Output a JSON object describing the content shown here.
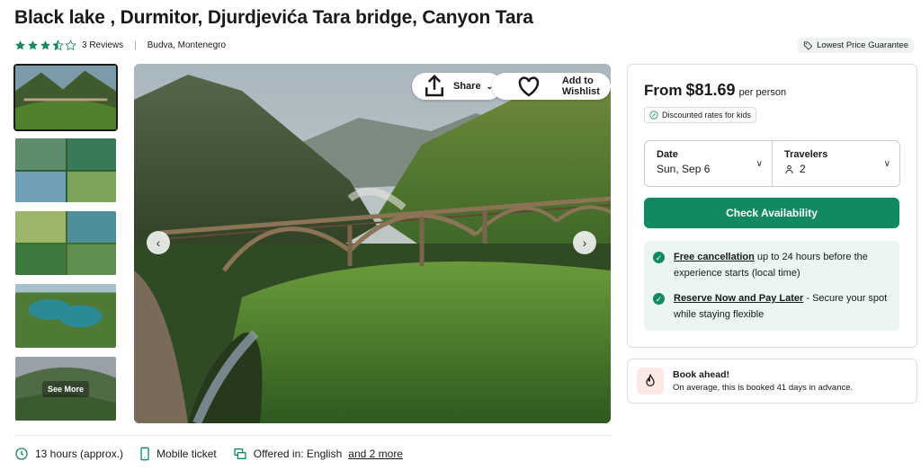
{
  "title": "Black lake , Durmitor, Djurdjevića Tara bridge, Canyon Tara",
  "rating": {
    "stars": 3.5,
    "reviews_label": "3 Reviews"
  },
  "location": "Budva, Montenegro",
  "guarantee_label": "Lowest Price Guarantee",
  "gallery": {
    "see_more": "See More",
    "share_label": "Share",
    "wishlist_label": "Add to Wishlist",
    "thumbnail_count": 5
  },
  "booking": {
    "from_label": "From",
    "price": "$81.69",
    "per_person": "per person",
    "discount_label": "Discounted rates for kids",
    "date_label": "Date",
    "date_value": "Sun, Sep 6",
    "travelers_label": "Travelers",
    "travelers_value": "2",
    "cta_label": "Check Availability",
    "perks": [
      {
        "title": "Free cancellation",
        "text": " up to 24 hours before the experience starts (local time)"
      },
      {
        "title": "Reserve Now and Pay Later",
        "text": " - Secure your spot while staying flexible"
      }
    ]
  },
  "book_ahead": {
    "title": "Book ahead!",
    "subtitle": "On average, this is booked 41 days in advance."
  },
  "features": {
    "duration": "13 hours (approx.)",
    "ticket": "Mobile ticket",
    "offered_in": "Offered in: English",
    "more_link": "and 2 more"
  },
  "colors": {
    "accent": "#118a63",
    "perk_bg": "#eaf6ef",
    "star": "#118a63"
  }
}
